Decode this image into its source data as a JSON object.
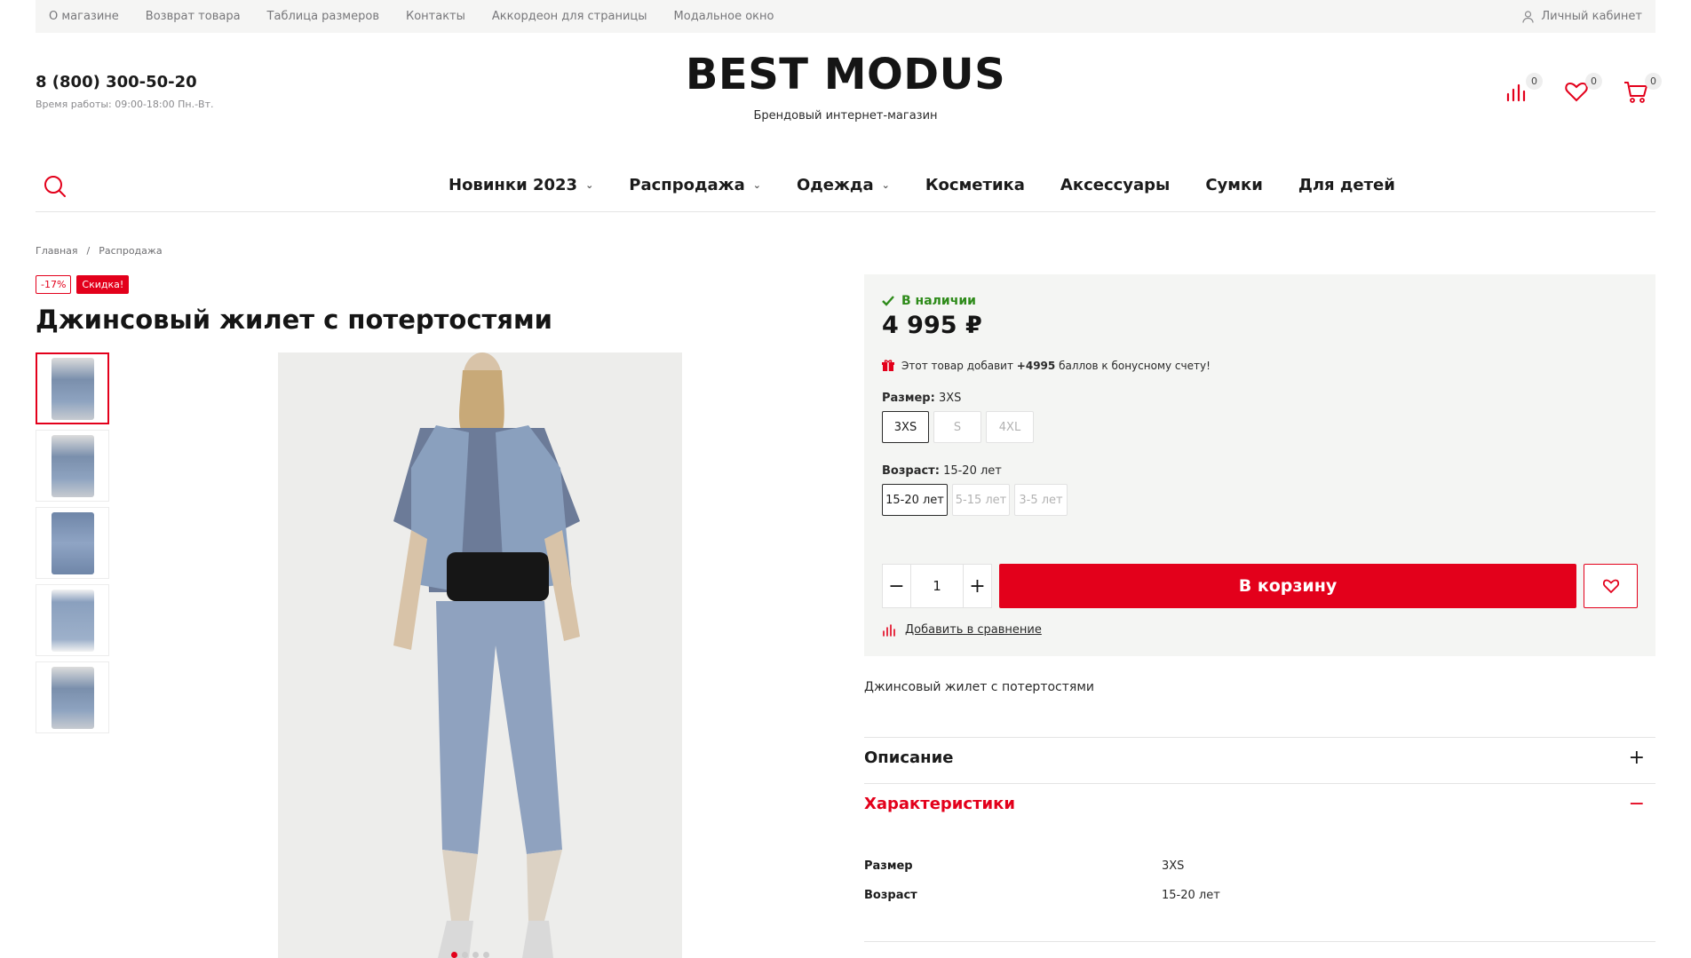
{
  "topbar": {
    "links": [
      "О магазине",
      "Возврат товара",
      "Таблица размеров",
      "Контакты",
      "Аккордеон для страницы",
      "Модальное окно"
    ],
    "account": "Личный кабинет"
  },
  "header": {
    "phone": "8 (800) 300-50-20",
    "hours": "Время работы: 09:00-18:00 Пн.-Вт.",
    "logo": "BEST MODUS",
    "tagline": "Брендовый интернет-магазин",
    "compare_count": "0",
    "favorites_count": "0",
    "cart_count": "0"
  },
  "nav": {
    "items": [
      {
        "label": "Новинки 2023",
        "dropdown": true
      },
      {
        "label": "Распродажа",
        "dropdown": true
      },
      {
        "label": "Одежда",
        "dropdown": true
      },
      {
        "label": "Косметика",
        "dropdown": false
      },
      {
        "label": "Аксессуары",
        "dropdown": false
      },
      {
        "label": "Сумки",
        "dropdown": false
      },
      {
        "label": "Для детей",
        "dropdown": false
      }
    ]
  },
  "breadcrumbs": [
    "Главная",
    "Распродажа"
  ],
  "breadcrumb_separator": "/",
  "badges": {
    "discount": "-17%",
    "sale": "Скидка!"
  },
  "product": {
    "title": "Джинсовый жилет с потертостями",
    "stock": "В наличии",
    "price": "4 995 ₽",
    "bonus_prefix": "Этот товар добавит",
    "bonus_points": "+4995",
    "bonus_suffix": "баллов к бонусному счету!",
    "size_label": "Размер:",
    "size_value": "3XS",
    "sizes": [
      "3XS",
      "S",
      "4XL"
    ],
    "age_label": "Возраст:",
    "age_value": "15-20 лет",
    "ages": [
      "15-20 лет",
      "5-15 лет",
      "3-5 лет"
    ],
    "quantity": "1",
    "qty_minus": "−",
    "qty_plus": "+",
    "add_to_cart": "В корзину",
    "compare_link": "Добавить в сравнение",
    "short_description": "Джинсовый жилет с потертостями"
  },
  "gallery": {
    "thumb_count": 5,
    "active_thumb": 1,
    "dots": 4,
    "active_dot": 1
  },
  "accordion": {
    "description_title": "Описание",
    "description_sign": "+",
    "specs_title": "Характеристики",
    "specs_sign": "−",
    "specs": [
      {
        "key": "Размер",
        "value": "3XS"
      },
      {
        "key": "Возраст",
        "value": "15-20 лет"
      }
    ]
  },
  "colors": {
    "accent": "#e3001b",
    "in_stock": "#2e8b1a",
    "topbar_bg": "#f5f5f4",
    "buybox_bg": "#f4f5f3"
  }
}
